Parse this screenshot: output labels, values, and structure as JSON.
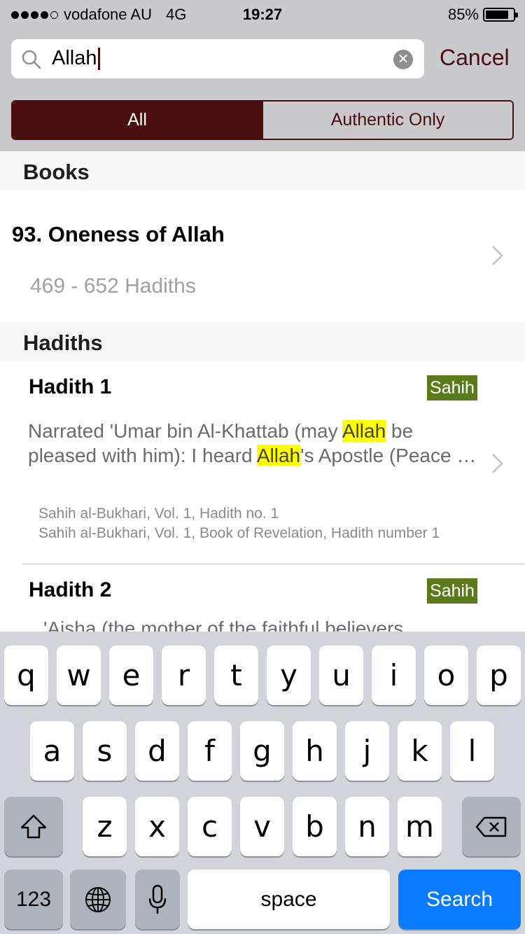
{
  "status_bar": {
    "carrier": "vodafone AU",
    "network": "4G",
    "time": "19:27",
    "battery_percent": "85%",
    "battery_level": 0.85,
    "signal_bars_filled": 4
  },
  "search": {
    "query": "Allah",
    "cancel_label": "Cancel"
  },
  "filter": {
    "all_label": "All",
    "authentic_label": "Authentic Only",
    "selected": "All"
  },
  "books_section": {
    "header": "Books",
    "items": [
      {
        "title": "93. Oneness of Allah",
        "range": "469 - 652 Hadiths"
      }
    ]
  },
  "hadiths_section": {
    "header": "Hadiths",
    "items": [
      {
        "title": "Hadith 1",
        "grade": "Sahih",
        "text_line1_a": "Narrated 'Umar bin Al-Khattab (may ",
        "text_line1_hl": "Allah",
        "text_line1_b": " be",
        "text_line2_a": "pleased with him):  I heard ",
        "text_line2_hl": "Allah",
        "text_line2_b": "'s Apostle (Peace be upon him) saying,",
        "ref1": "Sahih al-Bukhari, Vol. 1, Hadith no. 1",
        "ref2": "Sahih al-Bukhari, Vol. 1, Book of Revelation, Hadith number 1"
      },
      {
        "title": "Hadith 2",
        "grade": "Sahih",
        "text_peek": "'Aisha (the mother of the faithful believers"
      }
    ]
  },
  "keyboard": {
    "row1": [
      "q",
      "w",
      "e",
      "r",
      "t",
      "y",
      "u",
      "i",
      "o",
      "p"
    ],
    "row2": [
      "a",
      "s",
      "d",
      "f",
      "g",
      "h",
      "j",
      "k",
      "l"
    ],
    "row3": [
      "z",
      "x",
      "c",
      "v",
      "b",
      "n",
      "m"
    ],
    "numbers_label": "123",
    "space_label": "space",
    "search_label": "Search"
  },
  "colors": {
    "accent": "#4a0e0e",
    "sahih_badge": "#5a7a1c",
    "highlight": "#ffff00",
    "search_key": "#0a7aff"
  }
}
